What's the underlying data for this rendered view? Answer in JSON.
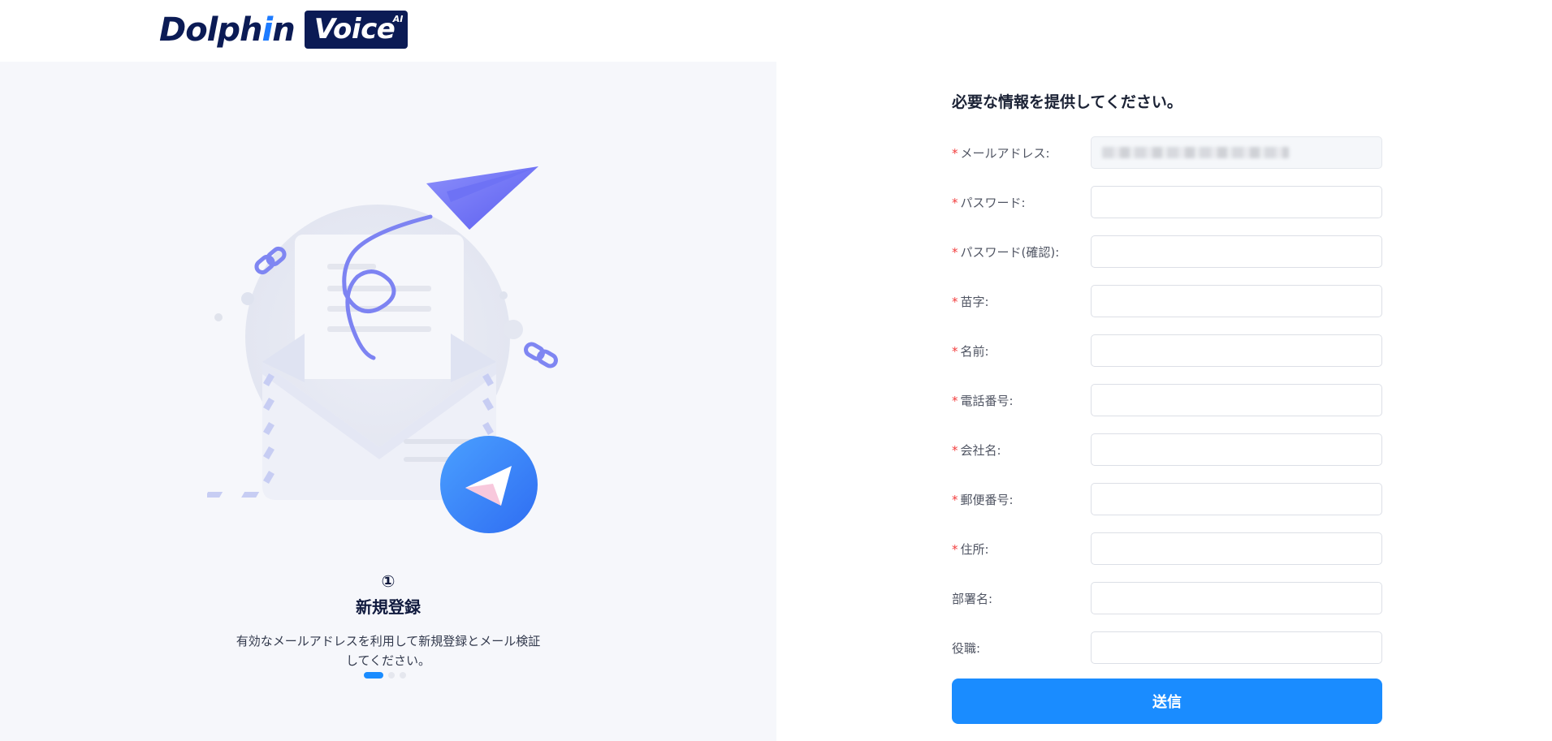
{
  "header": {
    "logo_dolphin_prefix": "Dolph",
    "logo_dolphin_i": "i",
    "logo_dolphin_suffix": "n",
    "logo_voice": "Voice",
    "logo_ai": "AI"
  },
  "left_panel": {
    "step_number": "①",
    "step_title": "新規登録",
    "step_description": "有効なメールアドレスを利用して新規登録とメール検証してください。",
    "carousel": {
      "total": 3,
      "active_index": 0
    }
  },
  "form": {
    "heading": "必要な情報を提供してください。",
    "required_mark": "*",
    "fields": [
      {
        "label": "メールアドレス:",
        "required": true,
        "value": "",
        "disabled": true
      },
      {
        "label": "パスワード:",
        "required": true,
        "value": ""
      },
      {
        "label": "パスワード(確認):",
        "required": true,
        "value": ""
      },
      {
        "label": "苗字:",
        "required": true,
        "value": ""
      },
      {
        "label": "名前:",
        "required": true,
        "value": ""
      },
      {
        "label": "電話番号:",
        "required": true,
        "value": ""
      },
      {
        "label": "会社名:",
        "required": true,
        "value": ""
      },
      {
        "label": "郵便番号:",
        "required": true,
        "value": ""
      },
      {
        "label": "住所:",
        "required": true,
        "value": ""
      },
      {
        "label": "部署名:",
        "required": false,
        "value": ""
      },
      {
        "label": "役職:",
        "required": false,
        "value": ""
      }
    ],
    "submit_label": "送信"
  },
  "colors": {
    "primary": "#1a8cff",
    "brand_navy": "#0b1b55",
    "required": "#f23d3d",
    "panel_bg": "#f6f7fb"
  }
}
